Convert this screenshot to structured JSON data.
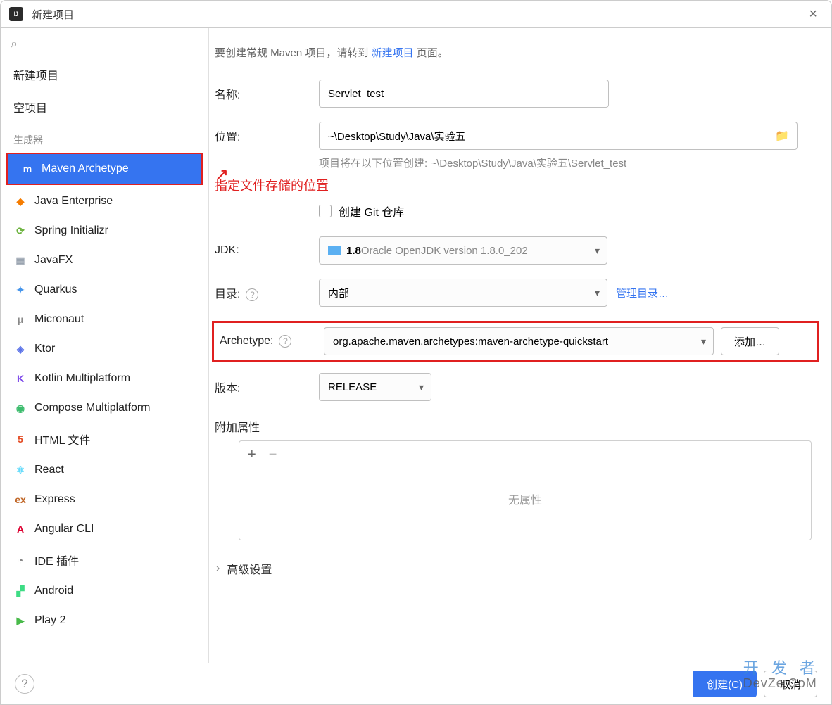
{
  "window": {
    "title": "新建项目",
    "close": "×"
  },
  "sidebar": {
    "new_project": "新建项目",
    "empty_project": "空项目",
    "section": "生成器",
    "generators": [
      {
        "name": "Maven Archetype",
        "iconColor": "#3574f0",
        "iconChar": "m",
        "selected": true
      },
      {
        "name": "Java Enterprise",
        "iconColor": "#f57c00",
        "iconChar": "◆"
      },
      {
        "name": "Spring Initializr",
        "iconColor": "#6db33f",
        "iconChar": "⟳"
      },
      {
        "name": "JavaFX",
        "iconColor": "#9aa4b0",
        "iconChar": "▦"
      },
      {
        "name": "Quarkus",
        "iconColor": "#4695eb",
        "iconChar": "✦"
      },
      {
        "name": "Micronaut",
        "iconColor": "#888",
        "iconChar": "μ"
      },
      {
        "name": "Ktor",
        "iconColor": "#5b73e8",
        "iconChar": "◈"
      },
      {
        "name": "Kotlin Multiplatform",
        "iconColor": "#7d48ea",
        "iconChar": "K"
      },
      {
        "name": "Compose Multiplatform",
        "iconColor": "#3cbc6d",
        "iconChar": "◉"
      },
      {
        "name": "HTML 文件",
        "iconColor": "#e44d26",
        "iconChar": "5"
      },
      {
        "name": "React",
        "iconColor": "#61dafb",
        "iconChar": "⚛"
      },
      {
        "name": "Express",
        "iconColor": "#c06728",
        "iconChar": "ex"
      },
      {
        "name": "Angular CLI",
        "iconColor": "#dd0031",
        "iconChar": "A"
      },
      {
        "name": "IDE 插件",
        "iconColor": "#888",
        "iconChar": "◔"
      },
      {
        "name": "Android",
        "iconColor": "#3ddc84",
        "iconChar": "▞"
      },
      {
        "name": "Play 2",
        "iconColor": "#49ba4a",
        "iconChar": "▶"
      }
    ]
  },
  "main": {
    "intro_prefix": "要创建常规 Maven 项目，请转到 ",
    "intro_link": "新建项目",
    "intro_suffix": " 页面。",
    "labels": {
      "name": "名称:",
      "location": "位置:",
      "jdk": "JDK:",
      "catalog": "目录:",
      "archetype": "Archetype:",
      "version": "版本:",
      "attrs_section": "附加属性",
      "advanced": "高级设置"
    },
    "values": {
      "name": "Servlet_test",
      "location": "~\\Desktop\\Study\\Java\\实验五",
      "location_hint": "项目将在以下位置创建: ~\\Desktop\\Study\\Java\\实验五\\Servlet_test",
      "git_checkbox": "创建 Git 仓库",
      "jdk_version": "1.8",
      "jdk_detail": " Oracle OpenJDK version 1.8.0_202",
      "catalog": "内部",
      "catalog_manage": "管理目录…",
      "archetype": "org.apache.maven.archetypes:maven-archetype-quickstart",
      "archetype_add": "添加…",
      "version": "RELEASE",
      "attrs_empty": "无属性"
    },
    "annotation": "指定文件存储的位置"
  },
  "footer": {
    "create": "创建(C)",
    "cancel": "取消"
  },
  "watermark": {
    "line1": "开 发 者",
    "line2": "DevZe.CoM"
  }
}
